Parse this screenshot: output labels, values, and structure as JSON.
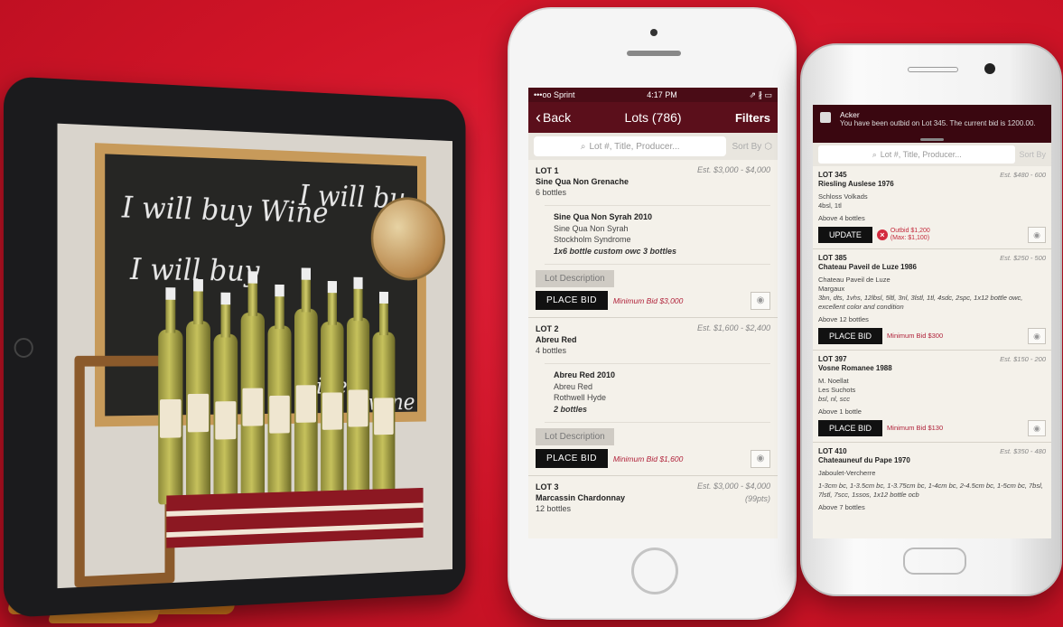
{
  "tablet": {
    "chalk_lines": [
      "I will buy Wine",
      "I will bu",
      "I will buy",
      "wine",
      "wine"
    ]
  },
  "iphone": {
    "status": {
      "carrier": "•••oo Sprint",
      "time": "4:17 PM",
      "icons": "⇗ ∦ ▭"
    },
    "nav": {
      "back_label": "Back",
      "title": "Lots (786)",
      "filters_label": "Filters"
    },
    "search": {
      "placeholder": "Lot #, Title, Producer...",
      "sort_label": "Sort By"
    },
    "lots": [
      {
        "lot": "LOT 1",
        "title": "Sine Qua Non Grenache",
        "qty": "6 bottles",
        "estimate": "Est. $3,000 - $4,000",
        "detail": {
          "name": "Sine Qua Non Syrah 2010",
          "line1": "Sine Qua Non Syrah",
          "line2": "Stockholm Syndrome",
          "line3": "1x6 bottle custom owc 3 bottles"
        },
        "desc_label": "Lot Description",
        "bid_label": "PLACE BID",
        "min_bid": "Minimum Bid $3,000"
      },
      {
        "lot": "LOT 2",
        "title": "Abreu Red",
        "qty": "4 bottles",
        "estimate": "Est. $1,600 - $2,400",
        "detail": {
          "name": "Abreu Red 2010",
          "line1": "Abreu Red",
          "line2": "Rothwell Hyde",
          "line3": "2 bottles"
        },
        "desc_label": "Lot Description",
        "bid_label": "PLACE BID",
        "min_bid": "Minimum Bid $1,600"
      },
      {
        "lot": "LOT 3",
        "title": "Marcassin Chardonnay",
        "qty": "12 bottles",
        "estimate": "Est. $3,000 - $4,000",
        "points": "(99pts)"
      }
    ]
  },
  "android": {
    "notification": {
      "app": "Acker",
      "message": "You have been outbid on Lot 345.  The current bid is 1200.00."
    },
    "search": {
      "placeholder": "Lot #, Title, Producer...",
      "sort_label": "Sort By"
    },
    "lots": [
      {
        "lot": "LOT 345",
        "title": "Riesling Auslese 1976",
        "estimate": "Est. $480 - 600",
        "lines": [
          "Schloss Volkads",
          "4bsl, 1tl"
        ],
        "above": "Above 4 bottles",
        "button": "UPDATE",
        "outbid": "Outbid $1,200",
        "outbid_max": "(Max: $1,100)"
      },
      {
        "lot": "LOT 385",
        "title": "Chateau Paveil de Luze 1986",
        "estimate": "Est. $250 - 500",
        "lines": [
          "Chateau Paveil de Luze",
          "Margaux"
        ],
        "note": "3bn, dts, 1vhs, 12lbsl, 5ltl, 3nl, 3lstl, 1tl, 4sdc, 2spc, 1x12 bottle owc, excellent color and condition",
        "above": "Above 12 bottles",
        "button": "PLACE BID",
        "min_bid": "Minimum Bid $300"
      },
      {
        "lot": "LOT 397",
        "title": "Vosne Romanee 1988",
        "estimate": "Est. $150 - 200",
        "lines": [
          "M. Noellat",
          "Les Suchots"
        ],
        "note": "bsl, nl, scc",
        "above": "Above 1 bottle",
        "button": "PLACE BID",
        "min_bid": "Minimum Bid $130"
      },
      {
        "lot": "LOT 410",
        "title": "Chateauneuf du Pape 1970",
        "estimate": "Est. $350 - 480",
        "lines": [
          "Jaboulet-Vercherre"
        ],
        "note": "1-3cm bc, 1-3.5cm bc, 1-3.75cm bc, 1-4cm bc, 2-4.5cm bc, 1-5cm bc, 7bsl, 7lstl, 7scc, 1ssos, 1x12 bottle ocb",
        "above": "Above 7 bottles"
      }
    ]
  },
  "colors": {
    "brand_red": "#d01427",
    "nav_maroon": "#5b0f1b",
    "bid_red": "#b0223a"
  }
}
